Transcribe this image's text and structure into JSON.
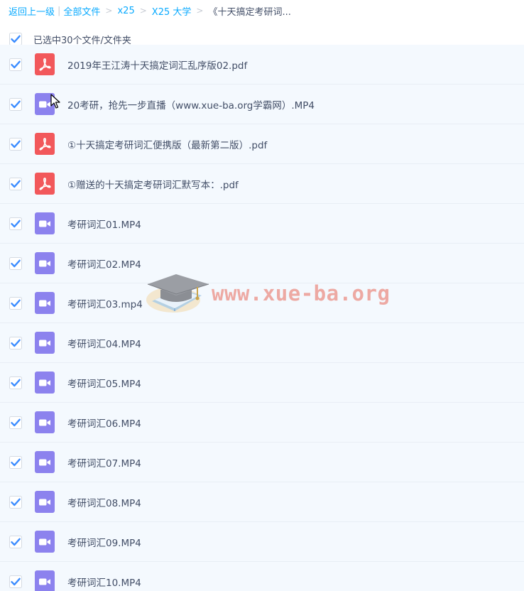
{
  "breadcrumb": {
    "back": "返回上一级",
    "all_files": "全部文件",
    "level1": "x25",
    "level2": "X25 大学",
    "current": "《十天搞定考研词..."
  },
  "select_all": {
    "label": "已选中30个文件/文件夹",
    "checked": true
  },
  "files": [
    {
      "name": "2019年王江涛十天搞定词汇乱序版02.pdf",
      "type": "pdf",
      "checked": true
    },
    {
      "name": "20考研，抢先一步直播（www.xue-ba.org学霸网）.MP4",
      "type": "video",
      "checked": true
    },
    {
      "name": "①十天搞定考研词汇便携版（最新第二版）.pdf",
      "type": "pdf",
      "checked": true
    },
    {
      "name": "①赠送的十天搞定考研词汇默写本：.pdf",
      "type": "pdf",
      "checked": true
    },
    {
      "name": "考研词汇01.MP4",
      "type": "video",
      "checked": true
    },
    {
      "name": "考研词汇02.MP4",
      "type": "video",
      "checked": true
    },
    {
      "name": "考研词汇03.mp4",
      "type": "video",
      "checked": true
    },
    {
      "name": "考研词汇04.MP4",
      "type": "video",
      "checked": true
    },
    {
      "name": "考研词汇05.MP4",
      "type": "video",
      "checked": true
    },
    {
      "name": "考研词汇06.MP4",
      "type": "video",
      "checked": true
    },
    {
      "name": "考研词汇07.MP4",
      "type": "video",
      "checked": true
    },
    {
      "name": "考研词汇08.MP4",
      "type": "video",
      "checked": true
    },
    {
      "name": "考研词汇09.MP4",
      "type": "video",
      "checked": true
    },
    {
      "name": "考研词汇10.MP4",
      "type": "video",
      "checked": true
    }
  ],
  "watermark": {
    "text": "www.xue-ba.org"
  },
  "colors": {
    "link": "#09aaff",
    "checkbox": "#3b8cff",
    "pdf_icon": "#f2585b",
    "video_icon": "#8c82ee",
    "row_bg": "#f4f9fe",
    "text": "#424e67"
  },
  "icons": {
    "checkbox": "checkmark-icon",
    "pdf": "pdf-file-icon",
    "video": "video-file-icon",
    "cursor": "mouse-pointer-icon",
    "watermark_logo": "graduation-cap-book-icon"
  }
}
